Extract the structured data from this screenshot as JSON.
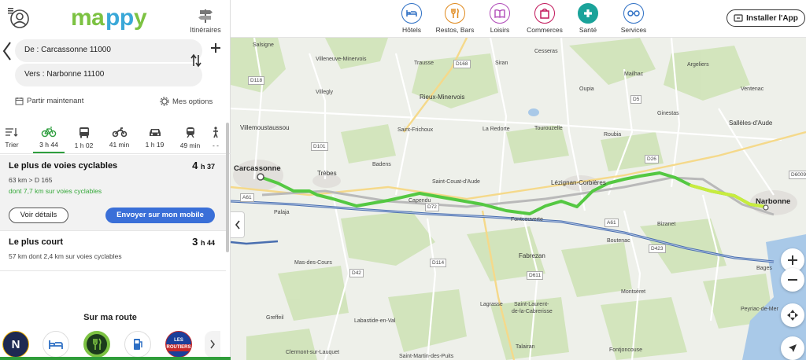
{
  "header": {
    "logo_text": "mappy",
    "itineraries_label": "Itinéraires"
  },
  "route_form": {
    "from": "De : Carcassonne 11000",
    "to": "Vers : Narbonne 11100",
    "depart_label": "Partir maintenant",
    "options_label": "Mes options"
  },
  "modes": [
    {
      "icon": "sort-icon",
      "label": "Trier"
    },
    {
      "icon": "bicycle-icon",
      "label": "3 h 44",
      "active": true
    },
    {
      "icon": "bus-icon",
      "label": "1 h 02"
    },
    {
      "icon": "motorbike-icon",
      "label": "41 min"
    },
    {
      "icon": "car-icon",
      "label": "1 h 19"
    },
    {
      "icon": "train-icon",
      "label": "49 min"
    },
    {
      "icon": "walk-icon",
      "label": "- -"
    }
  ],
  "routes": [
    {
      "title": "Le plus de voies cyclables",
      "time_h": "4",
      "time_m": "h 37",
      "sub": "63 km > D 165",
      "green": "dont 7,7 km sur voies cyclables",
      "details_label": "Voir détails",
      "send_label": "Envoyer sur mon mobile"
    },
    {
      "title": "Le plus court",
      "time_h": "3",
      "time_m": "h 44",
      "sub": "57 km dont 2,4 km sur voies cyclables"
    }
  ],
  "on_route": {
    "title": "Sur ma route",
    "poi_icons": [
      "logo-n-icon",
      "hotel-bed-icon",
      "restaurant-icon",
      "fuel-icon",
      "les-routiers-icon"
    ],
    "les_routiers_text": "LES ROUTIERS"
  },
  "categories": [
    {
      "icon": "hotel-icon",
      "label": "Hôtels",
      "color": "#2d6fc4"
    },
    {
      "icon": "restaurant-icon",
      "label": "Restos, Bars",
      "color": "#e08a1e"
    },
    {
      "icon": "leisure-icon",
      "label": "Loisirs",
      "color": "#b04ab8"
    },
    {
      "icon": "shopping-icon",
      "label": "Commerces",
      "color": "#c2185b"
    },
    {
      "icon": "health-icon",
      "label": "Santé",
      "color": "#1aa39a"
    },
    {
      "icon": "services-icon",
      "label": "Services",
      "color": "#2d6fc4"
    }
  ],
  "install_label": "Installer l'App",
  "map": {
    "towns": {
      "salsigne": "Salsigne",
      "villeneuve": "Villeneuve-Minervois",
      "trausse": "Trausse",
      "siran": "Siran",
      "cesseras": "Cesseras",
      "argeliers": "Argeliers",
      "mailhac": "Mailhac",
      "villegly": "Villegly",
      "rieux": "Rieux-Minervois",
      "oupia": "Oupia",
      "ventenac": "Ventenac",
      "villemoustaussou": "Villemoustaussou",
      "saint_frichoux": "Saint-Frichoux",
      "la_redorte": "La Redorte",
      "tourouzelle": "Tourouzelle",
      "ginestas": "Ginestas",
      "salleles": "Sallèles-d'Aude",
      "roubia": "Roubia",
      "badens": "Badens",
      "carcassonne": "Carcassonne",
      "trebes": "Trèbes",
      "saint_couat": "Saint-Couat-d'Aude",
      "lezignan": "Lézignan-Corbières",
      "narbonne": "Narbonne",
      "capendu": "Capendu",
      "palaja": "Palaja",
      "fontcouverte": "Fontcouverte",
      "bizanet": "Bizanet",
      "boutenac": "Boutenac",
      "fabrezan": "Fabrezan",
      "mas_des_cours": "Mas-des-Cours",
      "montseret": "Montséret",
      "bages": "Bages",
      "lagrasse": "Lagrasse",
      "saint_laurent": "Saint-Laurent-",
      "saint_laurent2": "de-la-Cabrerisse",
      "greffeil": "Greffeil",
      "labastide": "Labastide-en-Val",
      "talairan": "Talairan",
      "fontjoncouse": "Fontjoncouse",
      "peyriac": "Peyriac-de-Mer",
      "clermont": "Clermont-sur-Lauquet",
      "saint_martin": "Saint-Martin-des-Puits"
    },
    "roads": {
      "d118": "D118",
      "d168": "D168",
      "d5": "D5",
      "d101": "D101",
      "d26": "D26",
      "d6009": "D6009",
      "a61a": "A61",
      "a61b": "A61",
      "d72": "D72",
      "d114": "D114",
      "d42": "D42",
      "d611": "D611",
      "d423": "D423"
    }
  }
}
